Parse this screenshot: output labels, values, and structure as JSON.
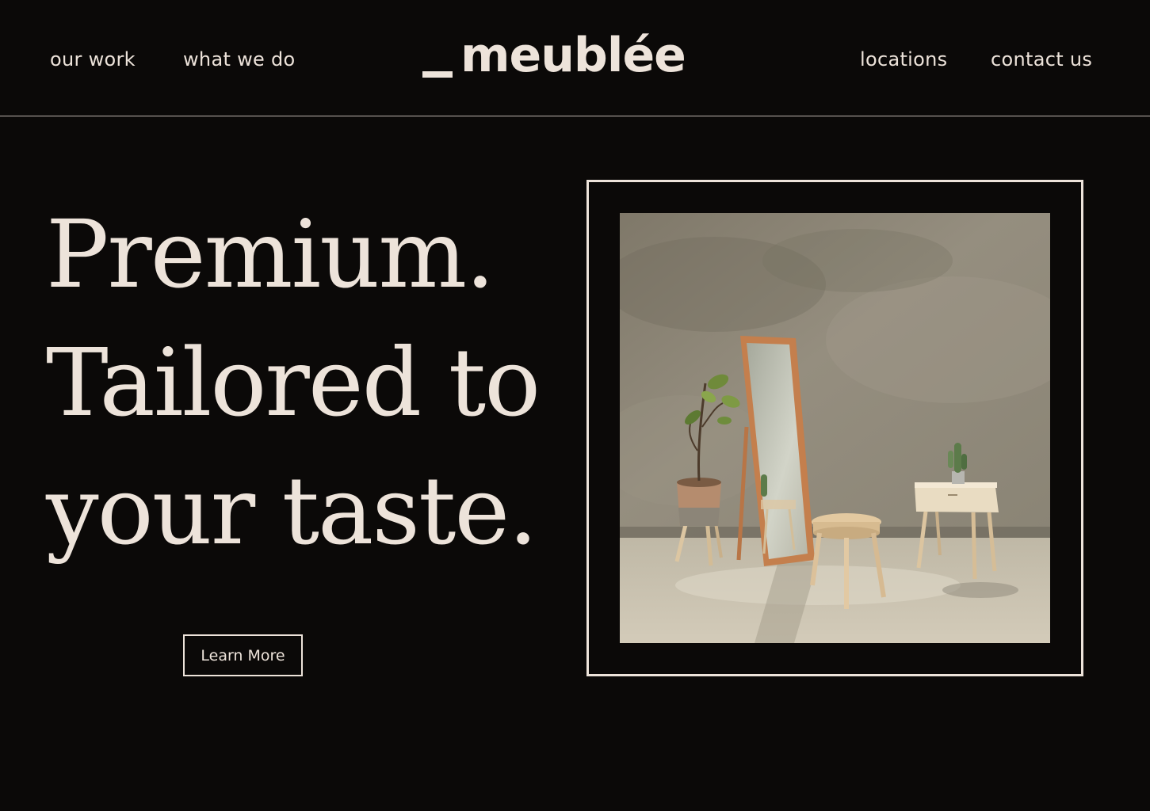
{
  "brand": {
    "name": "meublée"
  },
  "nav": {
    "left": [
      {
        "label": "our work"
      },
      {
        "label": "what we do"
      }
    ],
    "right": [
      {
        "label": "locations"
      },
      {
        "label": "contact us"
      }
    ]
  },
  "hero": {
    "headline": [
      "Premium.",
      "Tailored to",
      "your taste."
    ],
    "cta_label": "Learn More"
  },
  "colors": {
    "background": "#0b0908",
    "accent": "#ede3da"
  }
}
